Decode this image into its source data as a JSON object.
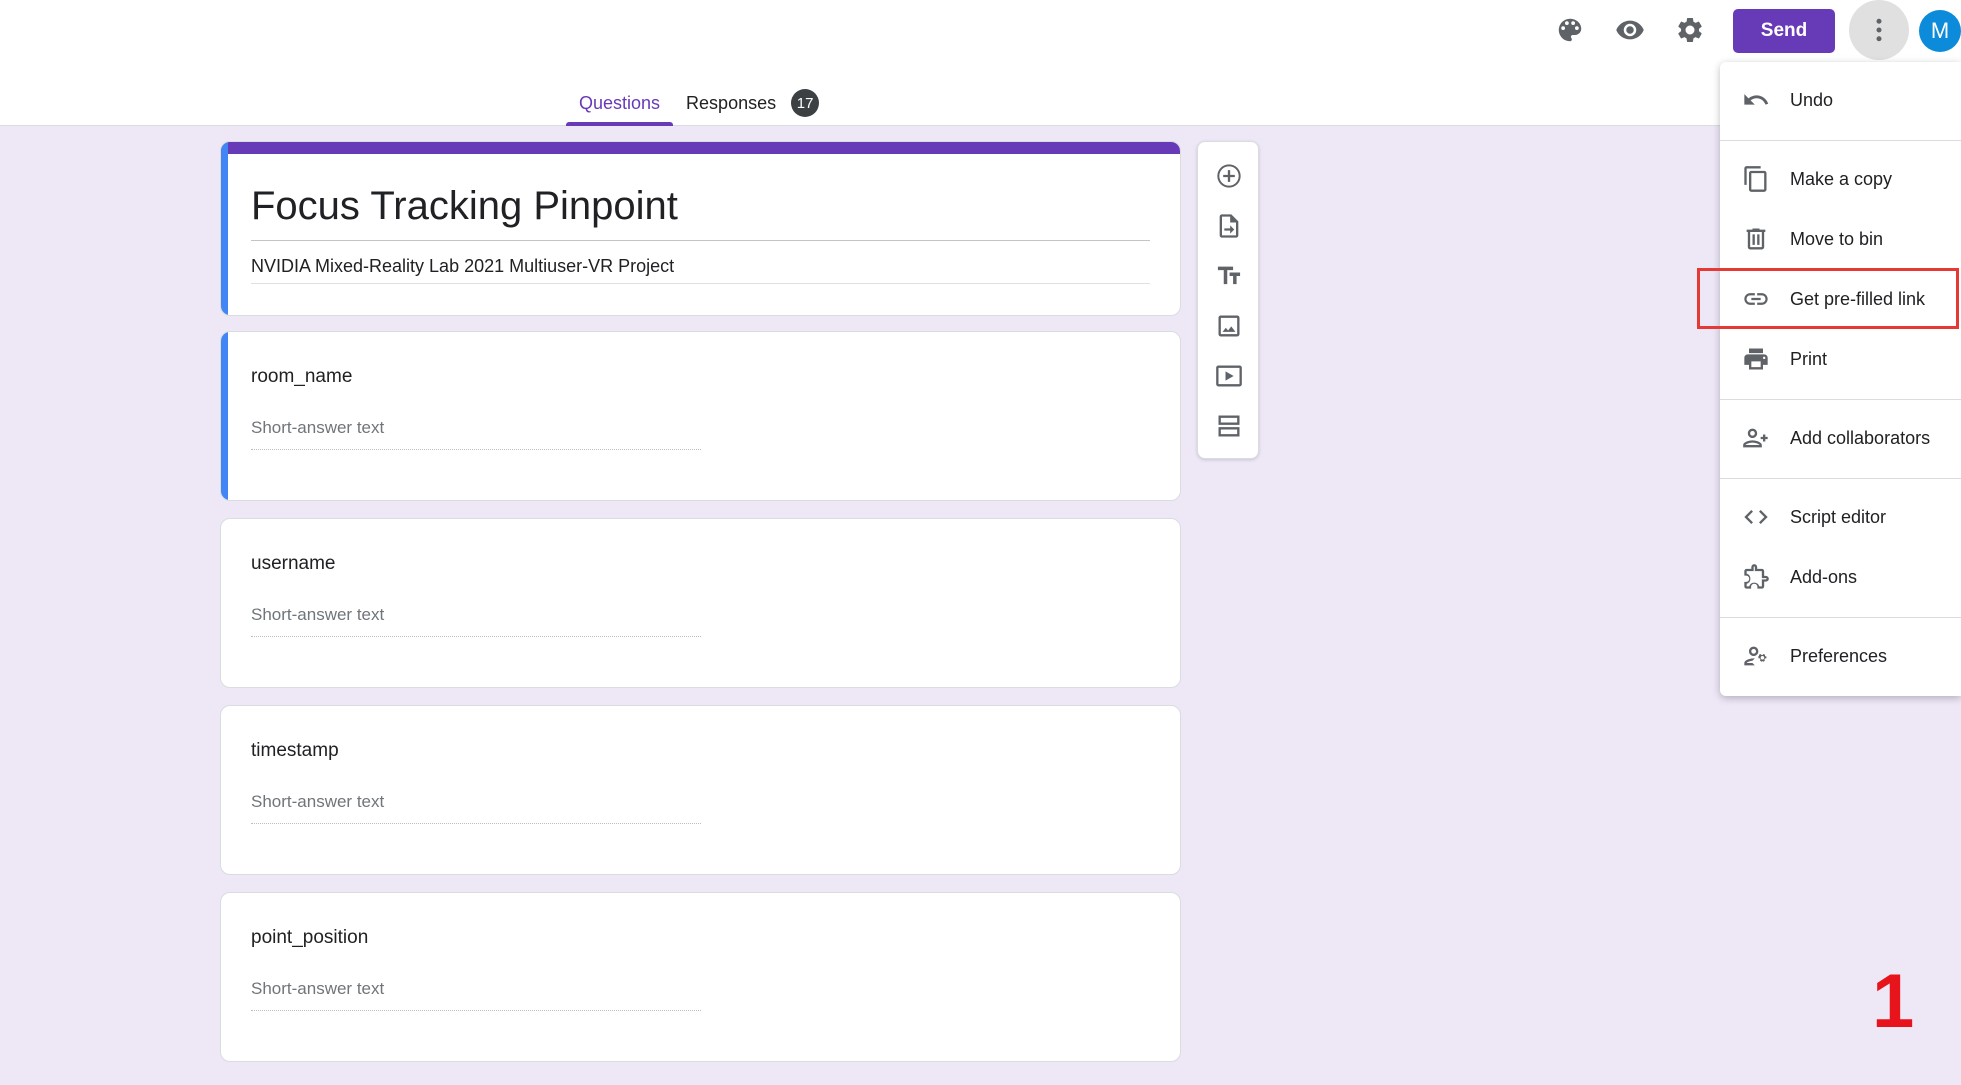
{
  "header": {
    "send_label": "Send",
    "avatar_letter": "M",
    "icons": [
      "palette-icon",
      "preview-icon",
      "settings-icon",
      "more-vert-icon"
    ]
  },
  "tabs": [
    {
      "label": "Questions",
      "active": true
    },
    {
      "label": "Responses",
      "badge": "17"
    }
  ],
  "form": {
    "title": "Focus Tracking Pinpoint",
    "description": "NVIDIA Mixed-Reality Lab 2021 Multiuser-VR Project"
  },
  "questions": [
    {
      "label": "room_name",
      "placeholder": "Short-answer text"
    },
    {
      "label": "username",
      "placeholder": "Short-answer text"
    },
    {
      "label": "timestamp",
      "placeholder": "Short-answer text"
    },
    {
      "label": "point_position",
      "placeholder": "Short-answer text"
    }
  ],
  "toolbar": [
    "add-question-icon",
    "import-questions-icon",
    "add-title-icon",
    "add-image-icon",
    "add-video-icon",
    "add-section-icon"
  ],
  "menu": {
    "items": [
      {
        "label": "Undo"
      },
      {
        "label": "Make a copy"
      },
      {
        "label": "Move to bin"
      },
      {
        "label": "Get pre-filled link"
      },
      {
        "label": "Print"
      },
      {
        "label": "Add collaborators"
      },
      {
        "label": "Script editor"
      },
      {
        "label": "Add-ons"
      },
      {
        "label": "Preferences"
      }
    ]
  },
  "annotation": {
    "step": "1"
  },
  "colors": {
    "accent": "#673ab7",
    "background": "#ede7f6",
    "selected_strip": "#4285f4",
    "highlight": "#e53935"
  }
}
